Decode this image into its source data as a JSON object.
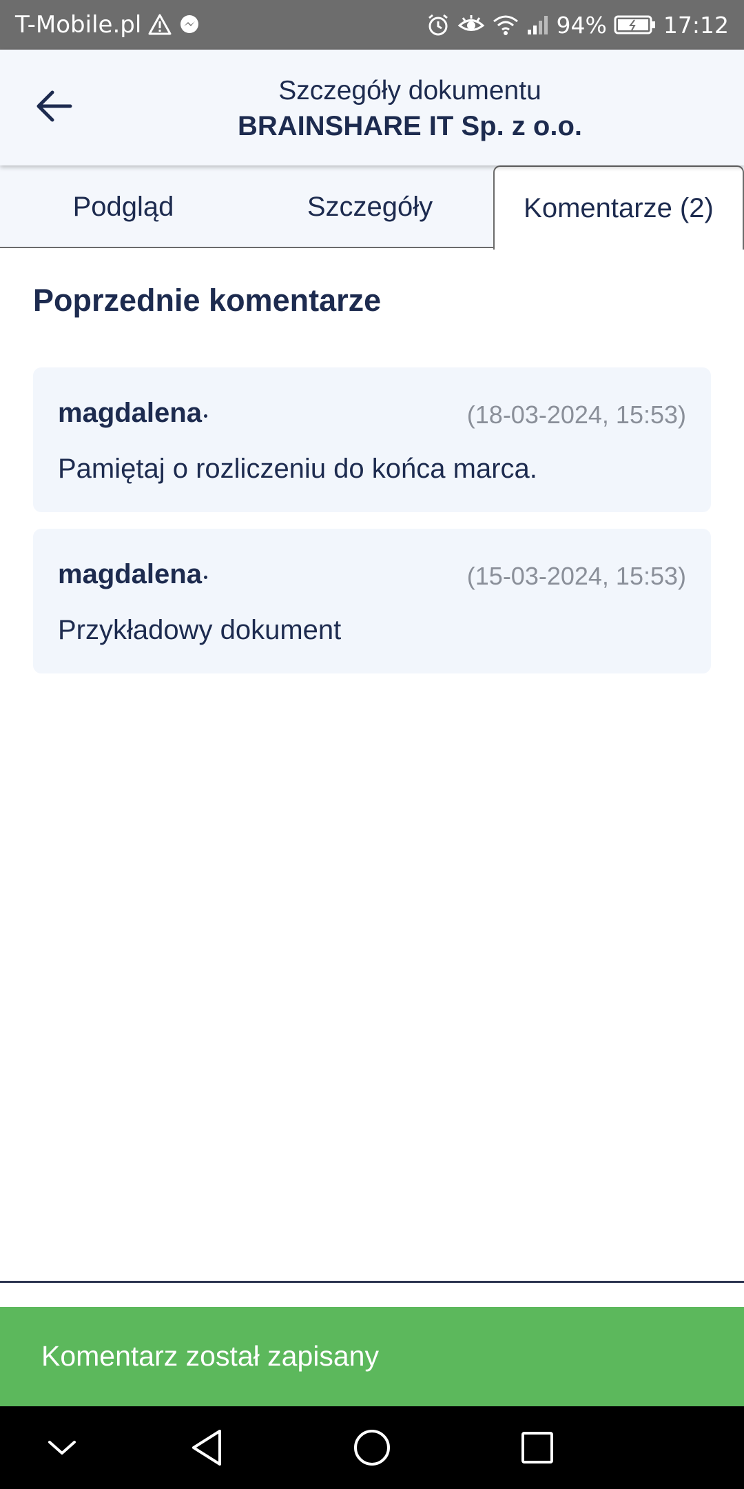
{
  "status_bar": {
    "carrier": "T-Mobile.pl",
    "battery": "94%",
    "time": "17:12"
  },
  "header": {
    "title": "Szczegóły dokumentu",
    "subtitle": "BRAINSHARE IT Sp. z o.o."
  },
  "tabs": [
    {
      "label": "Podgląd",
      "active": false
    },
    {
      "label": "Szczegóły",
      "active": false
    },
    {
      "label": "Komentarze (2)",
      "active": true
    }
  ],
  "comments_section": {
    "title": "Poprzednie komentarze",
    "items": [
      {
        "author": "magdalena",
        "date": "(18-03-2024, 15:53)",
        "text": "Pamiętaj o rozliczeniu do końca marca."
      },
      {
        "author": "magdalena",
        "date": "(15-03-2024, 15:53)",
        "text": "Przykładowy dokument"
      }
    ]
  },
  "toast": {
    "message": "Komentarz został zapisany",
    "color": "#5cb85c"
  },
  "colors": {
    "primary_text": "#1d2b4f",
    "card_background": "#f2f6fc",
    "date_text": "#8a8f99"
  }
}
